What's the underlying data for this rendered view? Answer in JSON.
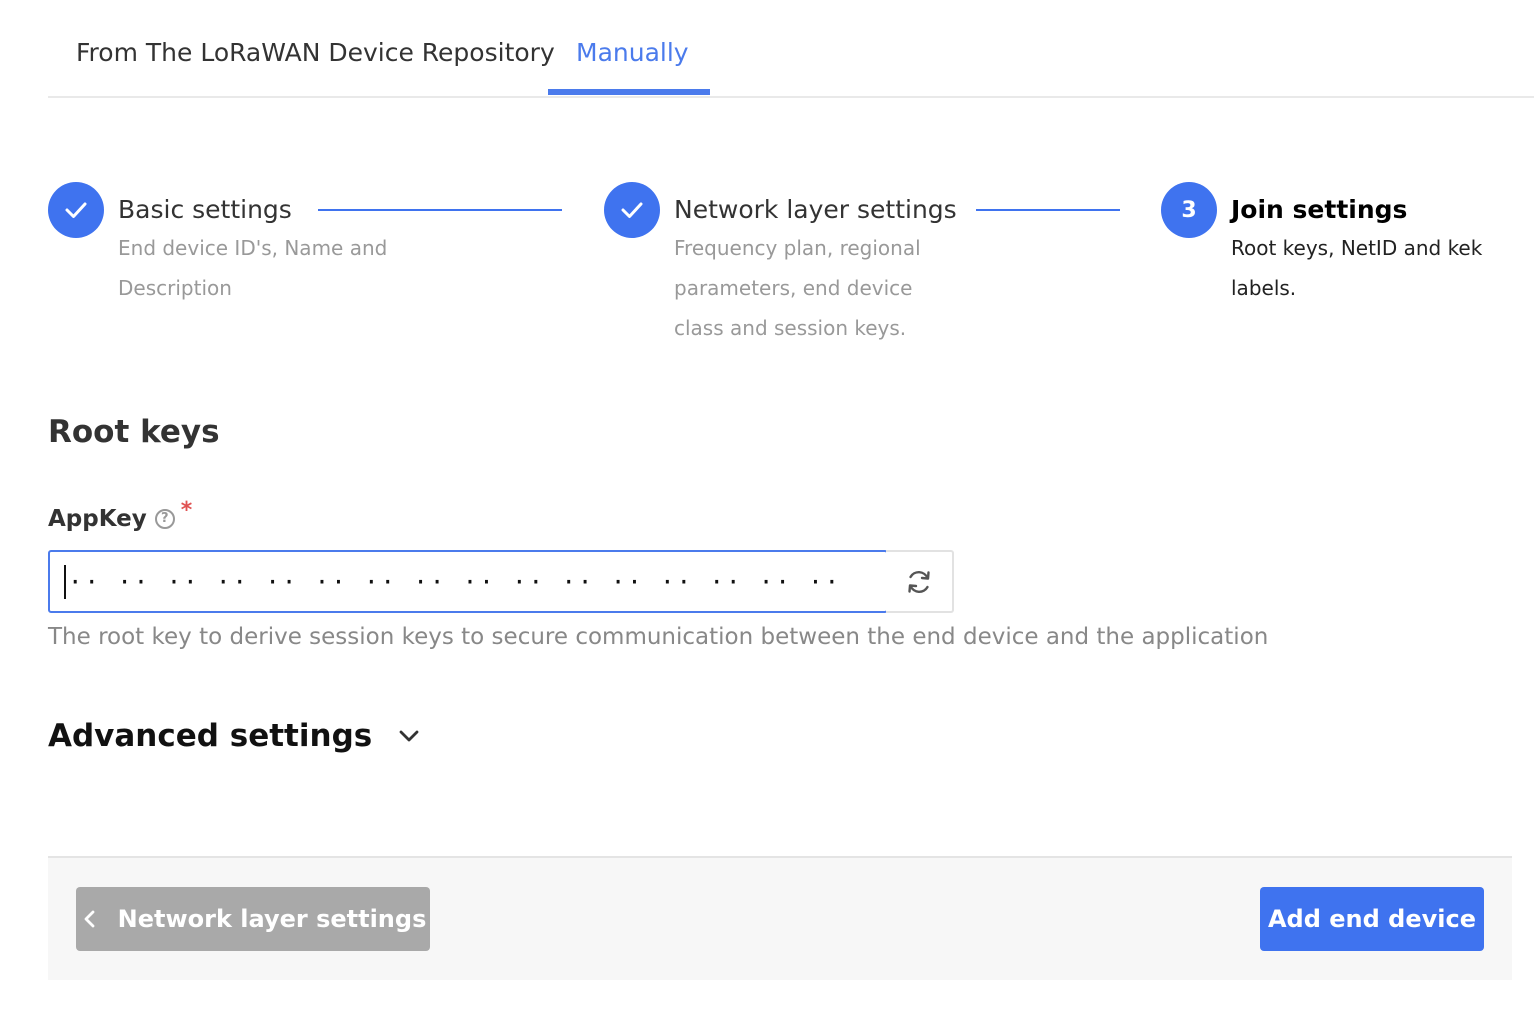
{
  "tabs": [
    {
      "label": "From The LoRaWAN Device Repository",
      "active": false
    },
    {
      "label": "Manually",
      "active": true
    }
  ],
  "steps": [
    {
      "number": "1",
      "title": "Basic settings",
      "description": "End device ID's, Name and Description",
      "status": "complete",
      "icon": "check-icon"
    },
    {
      "number": "2",
      "title": "Network layer settings",
      "description": "Frequency plan, regional parameters, end device class and session keys.",
      "status": "complete",
      "icon": "check-icon"
    },
    {
      "number": "3",
      "title": "Join settings",
      "description": "Root keys, NetID and kek labels.",
      "status": "active"
    }
  ],
  "root_keys": {
    "title": "Root keys",
    "appkey": {
      "label": "AppKey",
      "required_mark": "*",
      "value": "·· ·· ·· ·· ·· ·· ·· ·· ·· ·· ·· ·· ·· ·· ·· ··",
      "help_text": "The root key to derive session keys to secure communication between the end device and the application",
      "help_icon": "question-circle-icon",
      "regenerate_icon": "refresh-icon"
    }
  },
  "advanced": {
    "label": "Advanced settings",
    "icon": "chevron-down-icon"
  },
  "footer": {
    "back_label": "Network layer settings",
    "back_icon": "chevron-left-icon",
    "submit_label": "Add end device"
  },
  "colors": {
    "accent": "#3f73ef",
    "tab_active": "#4b7bec",
    "required": "#e05252",
    "disabled_button": "#a9a9a9"
  }
}
